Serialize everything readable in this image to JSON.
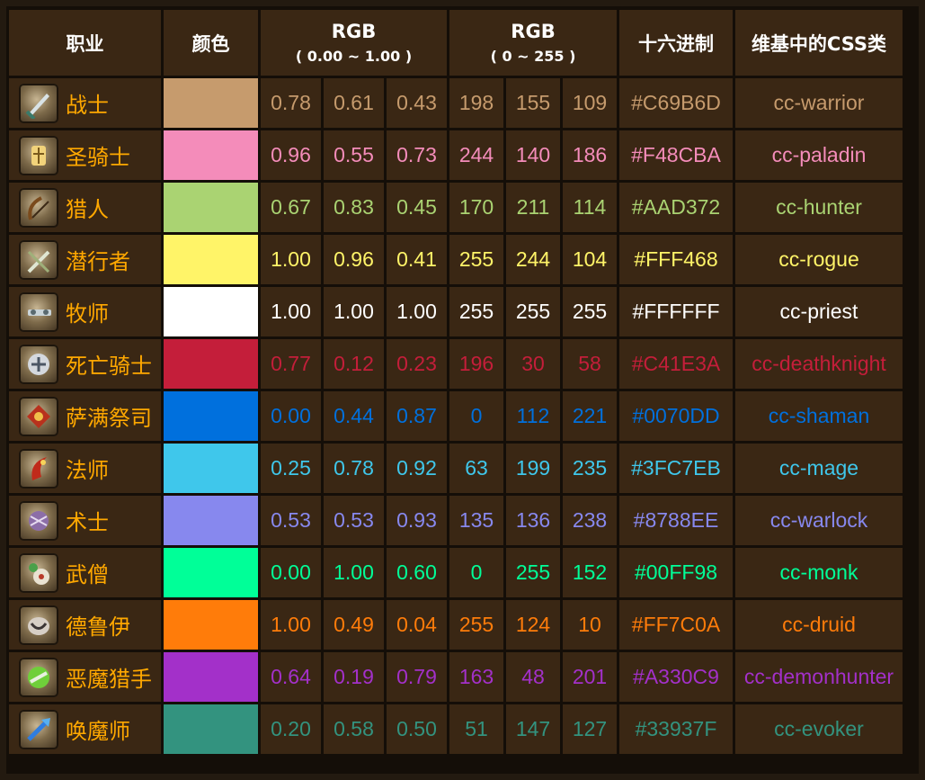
{
  "header": {
    "class_label": "职业",
    "color_label": "颜色",
    "rgb_float_label": "RGB",
    "rgb_float_range": "( 0.00 ~ 1.00 )",
    "rgb_int_label": "RGB",
    "rgb_int_range": "( 0 ~ 255 )",
    "hex_label": "十六进制",
    "css_label": "维基中的CSS类"
  },
  "rows": [
    {
      "name": "战士",
      "color": "#C69B6D",
      "r": "0.78",
      "g": "0.61",
      "b": "0.43",
      "ri": "198",
      "gi": "155",
      "bi": "109",
      "hex": "#C69B6D",
      "css": "cc-warrior",
      "icon": "warrior-icon"
    },
    {
      "name": "圣骑士",
      "color": "#F48CBA",
      "r": "0.96",
      "g": "0.55",
      "b": "0.73",
      "ri": "244",
      "gi": "140",
      "bi": "186",
      "hex": "#F48CBA",
      "css": "cc-paladin",
      "icon": "paladin-icon"
    },
    {
      "name": "猎人",
      "color": "#AAD372",
      "r": "0.67",
      "g": "0.83",
      "b": "0.45",
      "ri": "170",
      "gi": "211",
      "bi": "114",
      "hex": "#AAD372",
      "css": "cc-hunter",
      "icon": "hunter-icon"
    },
    {
      "name": "潜行者",
      "color": "#FFF468",
      "r": "1.00",
      "g": "0.96",
      "b": "0.41",
      "ri": "255",
      "gi": "244",
      "bi": "104",
      "hex": "#FFF468",
      "css": "cc-rogue",
      "icon": "rogue-icon"
    },
    {
      "name": "牧师",
      "color": "#FFFFFF",
      "r": "1.00",
      "g": "1.00",
      "b": "1.00",
      "ri": "255",
      "gi": "255",
      "bi": "255",
      "hex": "#FFFFFF",
      "css": "cc-priest",
      "icon": "priest-icon"
    },
    {
      "name": "死亡骑士",
      "color": "#C41E3A",
      "r": "0.77",
      "g": "0.12",
      "b": "0.23",
      "ri": "196",
      "gi": "30",
      "bi": "58",
      "hex": "#C41E3A",
      "css": "cc-deathknight",
      "icon": "deathknight-icon"
    },
    {
      "name": "萨满祭司",
      "color": "#0070DD",
      "r": "0.00",
      "g": "0.44",
      "b": "0.87",
      "ri": "0",
      "gi": "112",
      "bi": "221",
      "hex": "#0070DD",
      "css": "cc-shaman",
      "icon": "shaman-icon"
    },
    {
      "name": "法师",
      "color": "#3FC7EB",
      "r": "0.25",
      "g": "0.78",
      "b": "0.92",
      "ri": "63",
      "gi": "199",
      "bi": "235",
      "hex": "#3FC7EB",
      "css": "cc-mage",
      "icon": "mage-icon"
    },
    {
      "name": "术士",
      "color": "#8788EE",
      "r": "0.53",
      "g": "0.53",
      "b": "0.93",
      "ri": "135",
      "gi": "136",
      "bi": "238",
      "hex": "#8788EE",
      "css": "cc-warlock",
      "icon": "warlock-icon"
    },
    {
      "name": "武僧",
      "color": "#00FF98",
      "r": "0.00",
      "g": "1.00",
      "b": "0.60",
      "ri": "0",
      "gi": "255",
      "bi": "152",
      "hex": "#00FF98",
      "css": "cc-monk",
      "icon": "monk-icon"
    },
    {
      "name": "德鲁伊",
      "color": "#FF7C0A",
      "r": "1.00",
      "g": "0.49",
      "b": "0.04",
      "ri": "255",
      "gi": "124",
      "bi": "10",
      "hex": "#FF7C0A",
      "css": "cc-druid",
      "icon": "druid-icon"
    },
    {
      "name": "恶魔猎手",
      "color": "#A330C9",
      "r": "0.64",
      "g": "0.19",
      "b": "0.79",
      "ri": "163",
      "gi": "48",
      "bi": "201",
      "hex": "#A330C9",
      "css": "cc-demonhunter",
      "icon": "demonhunter-icon"
    },
    {
      "name": "唤魔师",
      "color": "#33937F",
      "r": "0.20",
      "g": "0.58",
      "b": "0.50",
      "ri": "51",
      "gi": "147",
      "bi": "127",
      "hex": "#33937F",
      "css": "cc-evoker",
      "icon": "evoker-icon"
    }
  ],
  "colors": {
    "class_name": "#FFA800",
    "header_text": "#FFFFFF",
    "cell_bg": "#3A2714",
    "grid_bg": "#140E08"
  }
}
